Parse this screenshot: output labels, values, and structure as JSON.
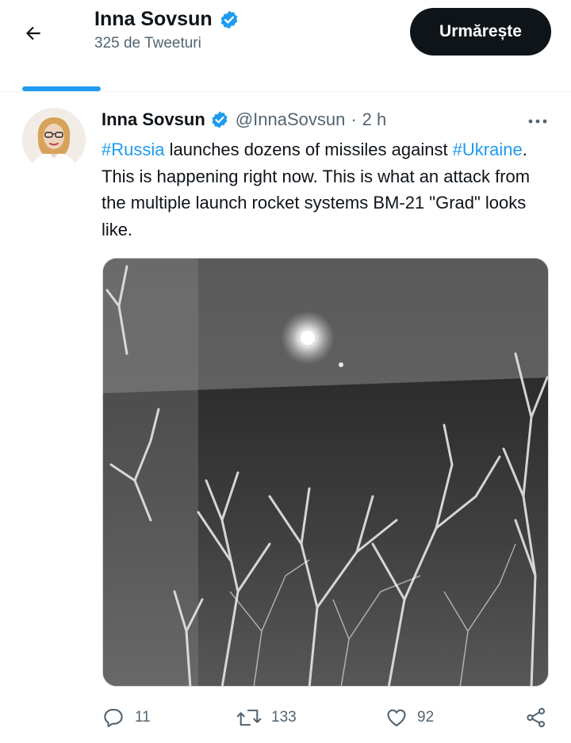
{
  "header": {
    "back_icon": "arrow-left-icon",
    "name": "Inna Sovsun",
    "subtitle": "325 de Tweeturi",
    "follow_label": "Urmărește",
    "verified_color": "#1d9bf0"
  },
  "tabs": {
    "active_indicator_color": "#1d9bf0"
  },
  "tweet": {
    "author_name": "Inna Sovsun",
    "handle": "@InnaSovsun",
    "separator": "·",
    "time": "2 h",
    "more_icon": "more-horizontal-icon",
    "text": {
      "hashtag1": "#Russia",
      "part1": " launches dozens of missiles against ",
      "hashtag2": "#Ukraine",
      "part2": ". This is happening right now. This is what an attack from the multiple launch rocket systems BM-21 \"Grad\" looks like."
    },
    "hashtag_color": "#1d9bf0",
    "media_type": "night-vision-video-thumbnail"
  },
  "actions": {
    "reply": {
      "icon": "reply-icon",
      "count": "11"
    },
    "retweet": {
      "icon": "retweet-icon",
      "count": "133"
    },
    "like": {
      "icon": "heart-icon",
      "count": "92"
    },
    "share": {
      "icon": "share-icon"
    }
  }
}
